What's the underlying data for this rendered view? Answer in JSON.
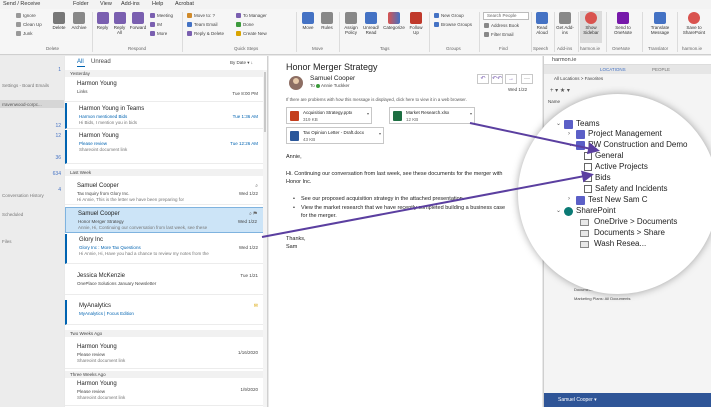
{
  "ribbon_tabs": [
    "Send / Receive",
    "Folder",
    "View",
    "Add-ins",
    "Help",
    "Acrobat"
  ],
  "ribbon": {
    "delete_group": {
      "ignore": "Ignore",
      "cleanup": "Clean Up",
      "junk": "Junk",
      "delete": "Delete",
      "archive": "Archive",
      "label": "Delete"
    },
    "respond_group": {
      "reply": "Reply",
      "reply_all": "Reply All",
      "forward": "Forward",
      "meeting": "Meeting",
      "im": "IM",
      "more": "More",
      "label": "Respond"
    },
    "quick_steps": {
      "items": [
        "Move to: ?",
        "Team Email",
        "Reply & Delete",
        "To Manager",
        "Done",
        "Create New"
      ],
      "label": "Quick Steps"
    },
    "move_group": {
      "move": "Move",
      "rules": "Rules",
      "label": "Move"
    },
    "tags_group": {
      "assign_policy": "Assign Policy",
      "unread_read": "Unread/ Read",
      "categorize": "Categorize",
      "follow_up": "Follow Up",
      "label": "Tags"
    },
    "groups_group": {
      "new_group": "New Group",
      "browse_groups": "Browse Groups",
      "label": "Groups"
    },
    "find_group": {
      "search_people": "Search People",
      "address_book": "Address Book",
      "filter_email": "Filter Email",
      "label": "Find"
    },
    "speech": {
      "read_aloud": "Read Aloud",
      "label": "Speech"
    },
    "addins": {
      "get_addins": "Get Add-ins",
      "label": "Add-ins"
    },
    "harmon_btn": {
      "show_sidebar": "Show Sidebar",
      "label": "harmon.ie"
    },
    "onenote": {
      "send": "Send to OneNote",
      "label": "OneNote"
    },
    "translator": {
      "translate": "Translate Message",
      "label": "Translator"
    },
    "sharepoint": {
      "save": "Save to SharePoint",
      "label": "harmon.ie"
    }
  },
  "folders": {
    "items": [
      "Settings - Board Emails",
      "rravenwood-corpc...",
      "Conversation History",
      "Scheduled",
      "Files"
    ],
    "counts": [
      "1",
      "12",
      "12",
      "36",
      "634",
      "4"
    ]
  },
  "message_list": {
    "tab_all": "All",
    "tab_unread": "Unread",
    "sort": "By Date ▾ ↓",
    "groups": [
      "Yesterday",
      "Last Week",
      "Two Weeks Ago",
      "Three Weeks Ago"
    ],
    "messages": [
      {
        "name": "Harmon Young",
        "subject": "Links",
        "preview": "",
        "date": "Tue 8:00 PM"
      },
      {
        "name": "Harmon Young in Teams",
        "subject": "Harmon mentioned Bids",
        "preview": "Hi Bids, I mention you in bids",
        "date": "Tue 1:36 AM"
      },
      {
        "name": "Harmon Young",
        "subject": "Please review",
        "preview": "Shareoint document link",
        "date": "Tue 12:26 AM"
      },
      {
        "name": "Samuel Cooper",
        "subject": "Tax Inquiry from Glory Inc.",
        "preview": "Hi Annie, This is the letter we have been preparing for",
        "date": "Wed 1/22"
      },
      {
        "name": "Samuel Cooper",
        "subject": "Honor Merger Strategy",
        "preview": "Annie, Hi, Continuing our conversation from last week, see these",
        "date": "Wed 1/22"
      },
      {
        "name": "Glory Inc",
        "subject": "Glory Inc : More Tax Questions",
        "preview": "Hi Annie, Hi, Have you had a chance to review my notes from the",
        "date": "Wed 1/22"
      },
      {
        "name": "Jessica McKenzie",
        "subject": "OnePlace Solutions January Newsletter",
        "preview": "",
        "date": "Tue 1/21"
      },
      {
        "name": "MyAnalytics",
        "subject": "MyAnalytics | Focus Edition",
        "preview": "",
        "date": ""
      },
      {
        "name": "Harmon Young",
        "subject": "Please review",
        "preview": "Shareoint document link",
        "date": "1/16/2020"
      },
      {
        "name": "Harmon Young",
        "subject": "Please review",
        "preview": "Shareoint document link",
        "date": "1/9/2020"
      }
    ]
  },
  "reading": {
    "subject": "Honor Merger Strategy",
    "sender": "Samuel Cooper",
    "to_label": "To",
    "to": "Annie Tuckker",
    "date": "Wed 1/22",
    "info": "If there are problems with how this message is displayed, click here to view it in a web browser.",
    "attachments": [
      {
        "name": "Acquisition Strategy.pptx",
        "size": "319 KB"
      },
      {
        "name": "Market Research.xlsx",
        "size": "12 KB"
      },
      {
        "name": "Tax Opinion Letter - Draft.docx",
        "size": "43 KB"
      }
    ],
    "greeting": "Annie,",
    "body1": "Hi. Continuing our conversation from last week, see these documents for the merger with",
    "body1b": "Honor Inc.",
    "bullet1": "See our proposed acquisition strategy in the attached presentation.",
    "bullet2": "View the market research that we have recently completed building a business case",
    "bullet2b": "for the merger.",
    "closing1": "Thanks,",
    "closing2": "Sam",
    "btn_reply": "↶",
    "btn_replyall": "↶↶",
    "btn_forward": "→",
    "btn_more": "···"
  },
  "harmon": {
    "brand": "harmon.ie",
    "tab_locations": "LOCATIONS",
    "tab_people": "PEOPLE",
    "crumb": "All Locations > Favorites",
    "tools": "+  ▾  ★  ▾",
    "name_header": "Name",
    "user": "Samuel Cooper ▾",
    "lower_items": [
      "Documents > Shared Documents",
      "Marketing Plans: All Documents"
    ]
  },
  "zoom": {
    "teams": "Teams",
    "project_mgmt": "Project Management",
    "rw": "RW Construction and Demo",
    "channels": [
      "General",
      "Active Projects",
      "Bids",
      "Safety and Incidents"
    ],
    "test_new": "Test New Sam C",
    "sharepoint": "SharePoint",
    "onedrive": "OneDrive > Documents",
    "docs_share": "Documents > Share",
    "wash": "Wash Resea..."
  },
  "colors": {
    "accent": "#0063b1",
    "arrow": "#5b3fa0",
    "teams": "#5b5fc7",
    "harmon_bar": "#2f5597"
  }
}
